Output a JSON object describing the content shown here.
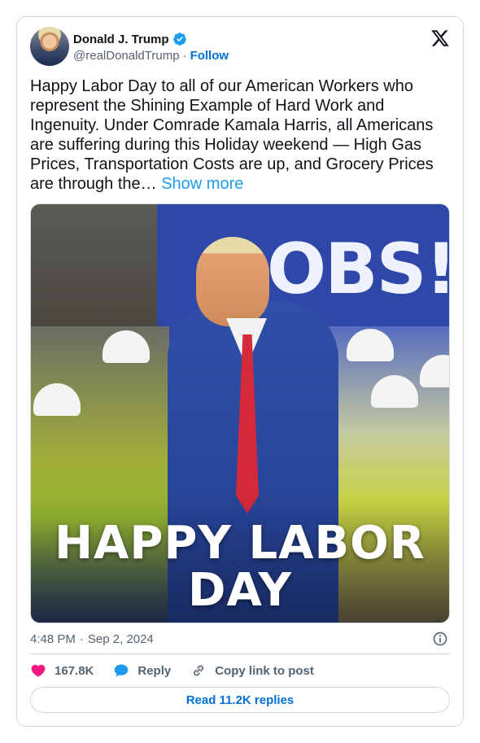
{
  "author": {
    "display_name": "Donald J. Trump",
    "handle": "@realDonaldTrump",
    "separator": "·",
    "follow_label": "Follow",
    "verified": true
  },
  "tweet": {
    "text": "Happy Labor Day to all of our American Workers who represent the Shining Example of Hard Work and Ingenuity. Under Comrade Kamala Harris, all Americans are suffering during this Holiday weekend — High Gas Prices, Transportation Costs are up, and Grocery Prices are through the…",
    "show_more_label": "Show more",
    "time": "4:48 PM",
    "date_separator": "·",
    "date": "Sep 2, 2024"
  },
  "media": {
    "caption_line1": "HAPPY LABOR",
    "caption_line2": "DAY",
    "banner_text": "OBS!"
  },
  "actions": {
    "likes": "167.8K",
    "reply_label": "Reply",
    "copy_link_label": "Copy link to post"
  },
  "replies_button": {
    "label": "Read 11.2K replies"
  },
  "icons": {
    "verified": "verified-badge-icon",
    "logo": "x-logo-icon",
    "info": "info-icon",
    "like": "heart-icon",
    "reply": "speech-bubble-icon",
    "link": "link-icon"
  },
  "colors": {
    "accent": "#1d9bf0",
    "link_blue": "#006fd6",
    "like_pink": "#f91880",
    "muted": "#536471",
    "border": "#cfd9de"
  }
}
